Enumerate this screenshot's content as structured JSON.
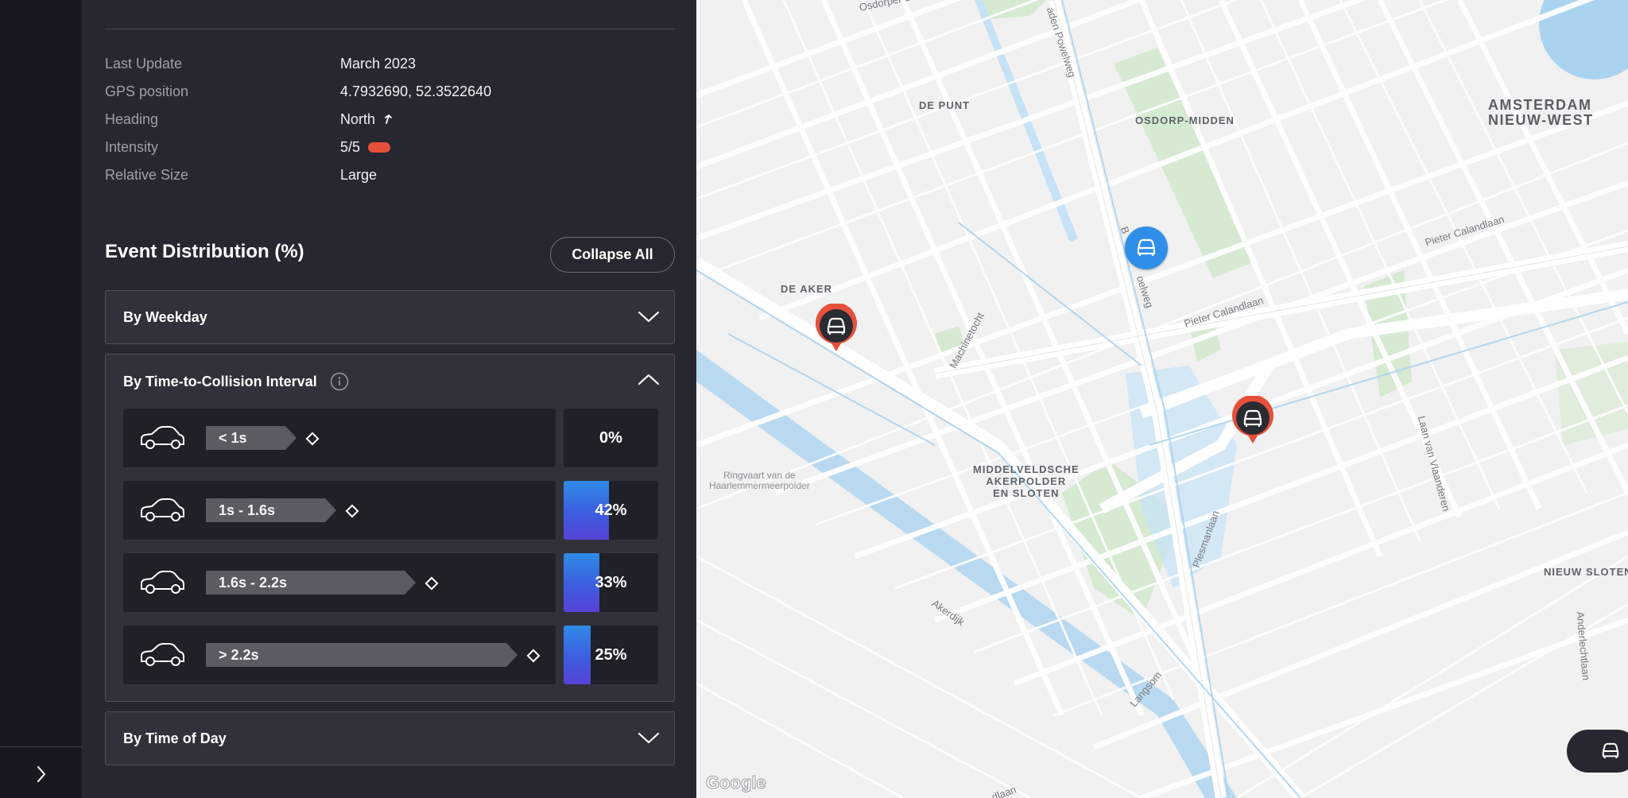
{
  "sidebar": {
    "expand_icon": "chevron-right-icon"
  },
  "details": {
    "rows": [
      {
        "label": "Last Update",
        "value": "March 2023"
      },
      {
        "label": "GPS position",
        "value": "4.7932690, 52.3522640"
      },
      {
        "label": "Heading",
        "value": "North",
        "icon": "arrow-up-right-icon"
      },
      {
        "label": "Intensity",
        "value": "5/5",
        "indicator_color": "#e6503a"
      },
      {
        "label": "Relative Size",
        "value": "Large"
      }
    ]
  },
  "event_distribution": {
    "title": "Event Distribution (%)",
    "collapse_all_label": "Collapse All",
    "sections": [
      {
        "title": "By Weekday",
        "expanded": false
      },
      {
        "title": "By Time-to-Collision Interval",
        "expanded": true,
        "intervals": [
          {
            "label": "< 1s",
            "percent_label": "0%",
            "percent": 0
          },
          {
            "label": "1s - 1.6s",
            "percent_label": "42%",
            "percent": 42
          },
          {
            "label": "1.6s - 2.2s",
            "percent_label": "33%",
            "percent": 33
          },
          {
            "label": "> 2.2s",
            "percent_label": "25%",
            "percent": 25
          }
        ]
      },
      {
        "title": "By Time of Day",
        "expanded": false
      }
    ]
  },
  "map": {
    "districts": {
      "de_punt": "DE PUNT",
      "osdorp_midden": "OSDORP-MIDDEN",
      "amsterdam_nw_1": "AMSTERDAM",
      "amsterdam_nw_2": "NIEUW-WEST",
      "de_aker": "DE AKER",
      "middelveldsche_1": "MIDDELVELDSCHE",
      "middelveldsche_2": "AKERPOLDER",
      "middelveldsche_3": "EN SLOTEN",
      "nieuw_sloten": "NIEUW SLOTEN"
    },
    "places": {
      "ringvaart_1": "Ringvaart van de",
      "ringvaart_2": "Haarlemmermeerpolder"
    },
    "streets": {
      "osdorper_ban": "Osdorper Ban",
      "powelweg_top": "aden Powelweg",
      "pieter_calandlaan_1": "Pieter Calandlaan",
      "pieter_calandlaan_2": "Pieter Calandlaan",
      "machinetocht": "Machinetocht",
      "akerdijk": "Akerdijk",
      "plesmanlaan": "Plesmanlaan",
      "laan_van_vlaanderen": "Laan van Vlaanderen",
      "anderlechtlaan": "Anderlechtlaan",
      "langsom": "Langsom",
      "powelweg_mid": "B",
      "powelweg_mid2": "oelweg",
      "bottom_laan": "dlaan"
    },
    "google_text": "Google",
    "pins": [
      {
        "type": "event",
        "color": "#e6503a",
        "icon": "car-icon"
      },
      {
        "type": "event",
        "color": "#e6503a",
        "icon": "car-icon"
      },
      {
        "type": "selected",
        "color": "#2f8fe8",
        "icon": "car-icon"
      }
    ],
    "fab_icon": "car-icon"
  }
}
